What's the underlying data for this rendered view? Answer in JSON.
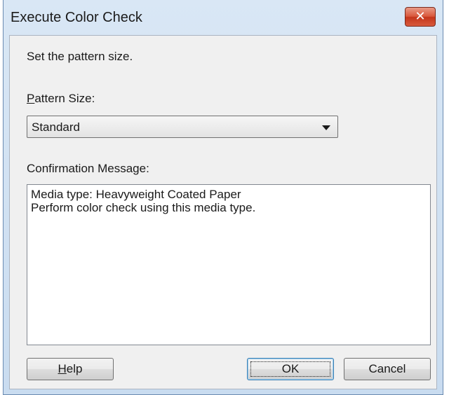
{
  "window": {
    "title": "Execute Color Check",
    "close_icon": "close-icon"
  },
  "instruction": "Set the pattern size.",
  "pattern_size": {
    "label_mnemonic": "P",
    "label_rest": "attern Size:",
    "selected": "Standard"
  },
  "confirmation": {
    "label": "Confirmation Message:",
    "lines": [
      "Media type: Heavyweight Coated Paper",
      "Perform color check using this media type."
    ]
  },
  "buttons": {
    "help_mnemonic": "H",
    "help_rest": "elp",
    "ok": "OK",
    "cancel": "Cancel"
  },
  "colors": {
    "close_button": "#d9573b",
    "title_bar": "#d9e7f5"
  }
}
